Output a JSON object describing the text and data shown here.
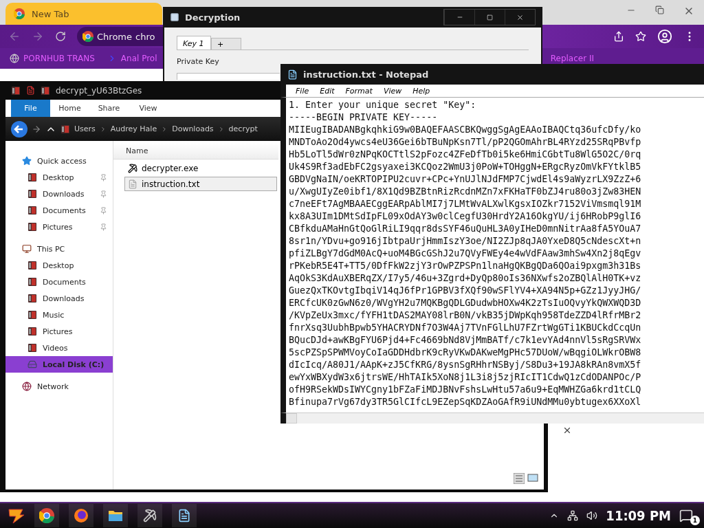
{
  "browser": {
    "tabs": [
      {
        "label": "New Tab",
        "selected": true
      }
    ],
    "omnibox": {
      "site": "Chrome",
      "url": "chro"
    },
    "bookmarks": [
      "PORNHUB TRANS",
      "Anal Prol",
      "Replacer II"
    ]
  },
  "decryption": {
    "title": "Decryption",
    "tabs": [
      {
        "label": "Key 1",
        "selected": true
      },
      {
        "label": "+",
        "selected": false
      }
    ],
    "private_key_label": "Private Key"
  },
  "explorer": {
    "title": "decrypt_yU63BtzGes",
    "ribbon_tabs": [
      {
        "label": "File",
        "selected": true
      },
      {
        "label": "Home",
        "selected": false
      },
      {
        "label": "Share",
        "selected": false
      },
      {
        "label": "View",
        "selected": false
      }
    ],
    "breadcrumb": [
      "Users",
      "Audrey Hale",
      "Downloads",
      "decrypt"
    ],
    "nav": [
      {
        "label": "Quick access",
        "kind": "star",
        "selected": false,
        "children": [
          {
            "label": "Desktop",
            "kind": "folder",
            "pinned": true,
            "selected": false
          },
          {
            "label": "Downloads",
            "kind": "folder",
            "pinned": true,
            "selected": false
          },
          {
            "label": "Documents",
            "kind": "folder",
            "pinned": true,
            "selected": false
          },
          {
            "label": "Pictures",
            "kind": "folder",
            "pinned": true,
            "selected": false
          }
        ]
      },
      {
        "label": "This PC",
        "kind": "pc",
        "selected": false,
        "children": [
          {
            "label": "Desktop",
            "kind": "folder",
            "pinned": false,
            "selected": false
          },
          {
            "label": "Documents",
            "kind": "folder",
            "pinned": false,
            "selected": false
          },
          {
            "label": "Downloads",
            "kind": "folder",
            "pinned": false,
            "selected": false
          },
          {
            "label": "Music",
            "kind": "folder",
            "pinned": false,
            "selected": false
          },
          {
            "label": "Pictures",
            "kind": "folder",
            "pinned": false,
            "selected": false
          },
          {
            "label": "Videos",
            "kind": "folder",
            "pinned": false,
            "selected": false
          },
          {
            "label": "Local Disk (C:)",
            "kind": "disk",
            "pinned": false,
            "selected": true
          }
        ]
      },
      {
        "label": "Network",
        "kind": "network",
        "selected": false
      }
    ],
    "column": "Name",
    "files": [
      {
        "name": "decrypter.exe",
        "kind": "exe",
        "selected": false
      },
      {
        "name": "instruction.txt",
        "kind": "txt",
        "selected": true
      }
    ]
  },
  "notepad": {
    "title": "instruction.txt - Notepad",
    "menu": [
      "File",
      "Edit",
      "Format",
      "View",
      "Help"
    ],
    "lines": [
      "1. Enter your unique secret \"Key\":",
      "-----BEGIN PRIVATE KEY-----",
      "MIIEugIBADANBgkqhkiG9w0BAQEFAASCBKQwggSgAgEAAoIBAQCtq36ufcDfy/ko",
      "MNDToAo2Od4ywcs4eU36Gei6bTBuNpKsn7Tl/pP2QGOmAhrBL4RYzd25SRqPBvfp",
      "Hb5LoTl5dWr0zNPqKOCTtlS2pFozc4ZFeDfTb0i5ke6HmiCGbtTu8WlG5O2C/0rq",
      "Uk4S9Rf3adEbFC2gsyaxei3KCQoz2WmU3j0PoW+TOHggN+ERgcRyzOmVkFYtklB5",
      "GBDVgNaIN/oeKRTOPIPU2cuvr+CPc+YnUJlNJdFMP7CjwdEl4s9aWyzrLX9ZzZ+6",
      "u/XwgUIyZe0ibf1/8X1Qd9BZBtnRizRcdnMZn7xFKHaTF0bZJ4ru80o3jZw83HEN",
      "c7neEFt7AgMBAAECggEARpAblMI7j7LMtWvALXwlKgsxIOZkr7152ViVmsmql91M",
      "kx8A3UIm1DMtSdIpFL09xOdAY3w0clCegfU30HrdY2A16OkgYU/ij6HRobP9glI6",
      "CBfkduAMaHnGtQoGlRiLI9qqr8dsSYF46uQuHL3A0yIHeD0mnNitrAa8fA5YOuA7",
      "8sr1n/YDvu+go916jIbtpaUrjHmmIszY3oe/NI2ZJp8qJA0YxeD8Q5cNdescXt+n",
      "pfiZLBgY7dGdM0AcQ+uoM4BGcGShJ2u7QVyFWEy4e4wVdFAaw3mhSw4Xn2j8qEgv",
      "rPKebR5E4T+TT5/0DfFkW2zjY3rOwPZPSPn1lnaHgQKBgQDa6QOai9pxgm3h31Bs",
      "AqOkS3KdAuXBERqZX/I7y5/46u+3Zgrd+DyQp80oIs36NXwfs2oZBQlAlH0TK+vz",
      "GuezQxTKOvtgIbqiV14qJ6fPr1GPBV3fXQf90wSFlYV4+XA94N5p+GZz1JyyJHG/",
      "ERCfcUK0zGwN6z0/WVgYH2u7MQKBgQDLGDudwbHOXw4K2zTsIuOQvyYkQWXWQD3D",
      "/KVpZeUx3mxc/fYFH1tDAS2MAY08lrB0N/vkB35jDWpKqh958TdeZZD4lRfrMBr2",
      "fnrXsq3UubhBpwb5YHACRYDNf7O3W4Aj7TVnFGlLhU7FZrtWgGTi1KBUCkdCcqUn",
      "BQucDJd+awKBgFYU6Pjd4+Fc4669bNd8VjMmBATf/c7k1evYAd4nnVl5sRgSRVWx",
      "5scPZSpSPWMVoyCoIaGDDHdbrK9cRyVKwDAKweMgPHc57DUoW/wBqgiOLWkrOBW8",
      "dIcIcq/A80J1/AApK+zJ5CfKRG/8ysnSgRHhrNSByj/S8Du3+19JA8kRAn8vmX5f",
      "ewYxWBXydW3x6jtrsWE/HhTAIk5XoN8j1L3i8j5zjRIcIT1CdwQ1zCdODANPOc/P",
      "ofH9RSekWDsIWYCgny1bFZaFiMDJBNvFshsLwHtu57a6u9+EqMWHZGa6krd1tCLQ",
      "Bfinupa7rVg67dy3TR5GlCIfcL9EZepSqKDZAoGAfR9iUNdMMu0ybtugex6XXoXl"
    ]
  },
  "taskbar": {
    "apps": [
      {
        "kind": "chrome"
      },
      {
        "kind": "firefox"
      },
      {
        "kind": "folder"
      },
      {
        "kind": "pickaxe"
      },
      {
        "kind": "notepad"
      }
    ],
    "clock": "11:09 PM",
    "notifications": "1"
  }
}
